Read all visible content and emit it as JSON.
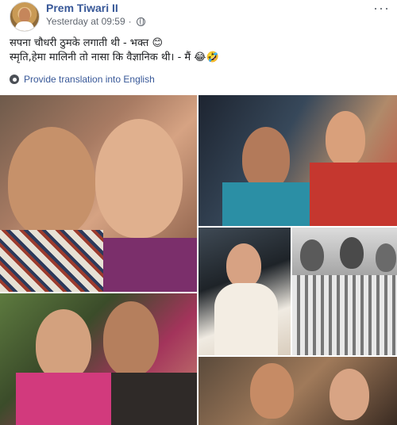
{
  "post": {
    "author": "Prem Tiwari II",
    "timestamp": "Yesterday at 09:59",
    "privacy_icon": "globe-icon",
    "more_label": "···",
    "text_line1": "सपना चौधरी ठुमके लगाती थी - भक्त 😊",
    "text_line2": "स्मृति,हेमा मालिनी तो नासा कि वैज्ञानिक थी। - मैं 😂🤣",
    "translate_label": "Provide translation into English"
  },
  "photos": [
    {
      "name": "photo-1"
    },
    {
      "name": "photo-2"
    },
    {
      "name": "photo-3"
    },
    {
      "name": "photo-4"
    },
    {
      "name": "photo-5"
    },
    {
      "name": "photo-6"
    }
  ]
}
